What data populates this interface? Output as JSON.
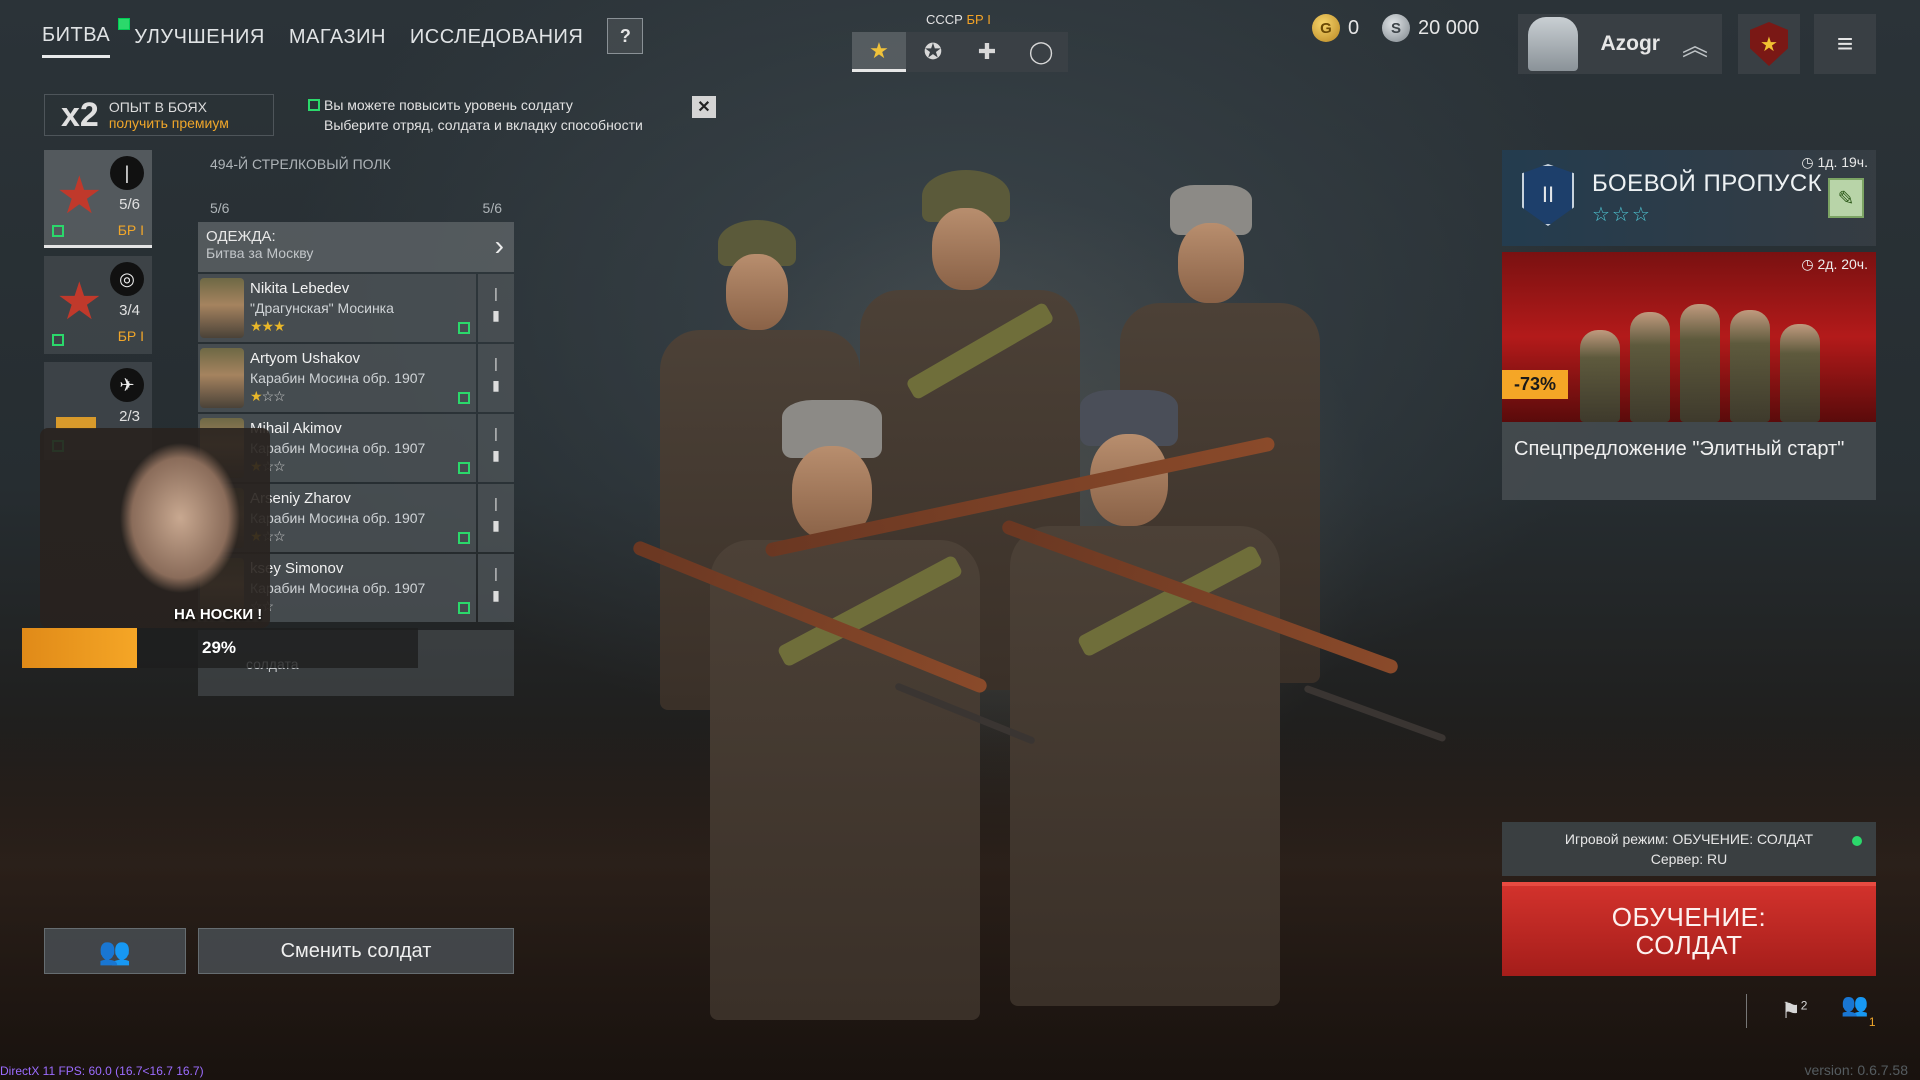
{
  "nav": {
    "tabs": [
      "БИТВА",
      "УЛУЧШЕНИЯ",
      "МАГАЗИН",
      "ИССЛЕДОВАНИЯ"
    ],
    "help_label": "?"
  },
  "nation": {
    "name": "СССР",
    "br": "БР I"
  },
  "currency": {
    "gold": "0",
    "silver": "20 000",
    "gold_symbol": "G",
    "silver_symbol": "S"
  },
  "profile": {
    "name": "Azogr"
  },
  "exp": {
    "multiplier": "x2",
    "label": "ОПЫТ В БОЯХ",
    "premium_link": "получить премиум"
  },
  "notification": {
    "line1": "Вы можете повысить уровень солдату",
    "line2": "Выберите отряд, солдата и вкладку способности",
    "close": "✕"
  },
  "squads": [
    {
      "emblem": "★",
      "class_icon": "|",
      "count": "5/6",
      "br": "БР I"
    },
    {
      "emblem": "★",
      "class_icon": "◎",
      "count": "3/4",
      "br": "БР I"
    },
    {
      "emblem": "▬",
      "class_icon": "✈",
      "count": "2/3",
      "br": ""
    }
  ],
  "regiment": {
    "title": "494-Й СТРЕЛКОВЫЙ ПОЛК",
    "count_left": "5/6",
    "count_right": "5/6",
    "outfit_label": "ОДЕЖДА:",
    "outfit_value": "Битва за Москву"
  },
  "soldiers": [
    {
      "name": "Nikita Lebedev",
      "weapon": "\"Драгунская\" Мосинка",
      "stars_on": "★★★",
      "stars_off": ""
    },
    {
      "name": "Artyom Ushakov",
      "weapon": "Карабин Мосина обр. 1907",
      "stars_on": "★",
      "stars_off": "☆☆"
    },
    {
      "name": "Mihail Akimov",
      "weapon": "Карабин Мосина обр. 1907",
      "stars_on": "★",
      "stars_off": "☆☆"
    },
    {
      "name": "Arseniy Zharov",
      "weapon": "Карабин Мосина обр. 1907",
      "stars_on": "★",
      "stars_off": "☆☆"
    },
    {
      "name": "ksey Simonov",
      "weapon": "Карабин Мосина обр. 1907",
      "stars_on": "",
      "stars_off": "☆☆"
    }
  ],
  "free_slot": "солдата",
  "stream": {
    "label": "НА НОСКИ !",
    "progress_pct": 29,
    "progress_text": "29%"
  },
  "buttons": {
    "change_soldier": "Сменить солдат",
    "squad_icon": "👥"
  },
  "battle_pass": {
    "title": "БОЕВОЙ ПРОПУСК",
    "stars": "☆☆☆",
    "timer": "1д. 19ч.",
    "emblem_text": "II"
  },
  "offer": {
    "timer": "2д. 20ч.",
    "discount": "-73%",
    "title": "Спецпредложение \"Элитный старт\""
  },
  "mode": {
    "line1": "Игровой режим: ОБУЧЕНИЕ: СОЛДАТ",
    "line2": "Сервер: RU"
  },
  "play": {
    "line1": "ОБУЧЕНИЕ:",
    "line2": "СОЛДАТ"
  },
  "bottom": {
    "flag_count": "2",
    "friends_count": "1"
  },
  "footer": {
    "fps": "DirectX 11 FPS: 60.0 (16.7<16.7 16.7)",
    "version": "version: 0.6.7.58"
  }
}
